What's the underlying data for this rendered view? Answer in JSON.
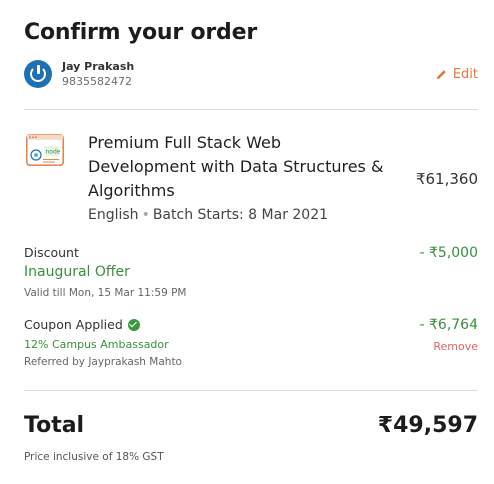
{
  "header": {
    "title": "Confirm your order"
  },
  "user": {
    "name": "Jay Prakash",
    "phone": "9835582472",
    "edit_label": "Edit"
  },
  "course": {
    "title": "Premium Full Stack Web Development with Data Structures & Algorithms",
    "language": "English",
    "batch": "Batch Starts: 8 Mar 2021",
    "price": "₹61,360",
    "icon_text": "node"
  },
  "discount": {
    "label": "Discount",
    "offer": "Inaugural Offer",
    "validity": "Valid till Mon, 15 Mar 11:59 PM",
    "amount": "- ₹5,000"
  },
  "coupon": {
    "label": "Coupon Applied",
    "description": "12% Campus Ambassador",
    "referred_by": "Referred by Jayprakash Mahto",
    "amount": "- ₹6,764",
    "remove_label": "Remove"
  },
  "total": {
    "label": "Total",
    "amount": "₹49,597",
    "note": "Price inclusive of 18% GST"
  },
  "colors": {
    "accent": "#e0763a",
    "success": "#3a8f3f",
    "danger": "#e26262",
    "avatar": "#1f6fb5"
  }
}
